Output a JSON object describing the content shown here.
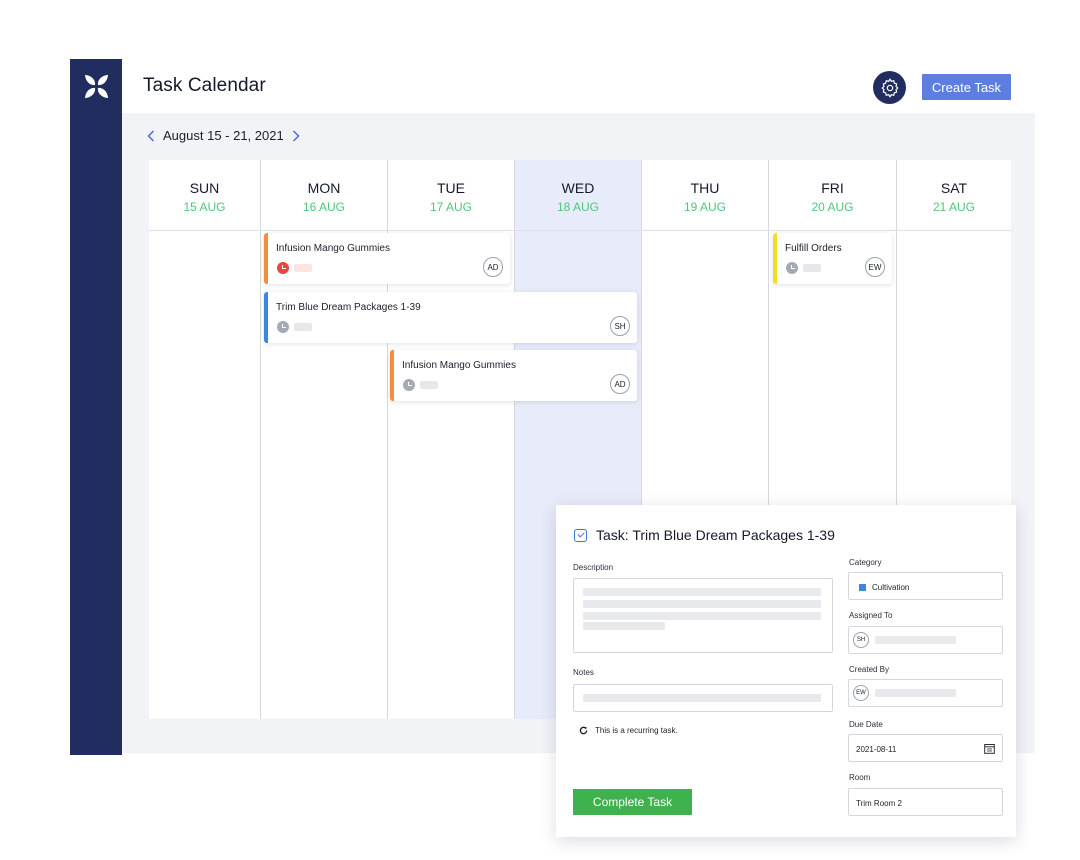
{
  "header": {
    "title": "Task Calendar",
    "create_label": "Create Task"
  },
  "nav": {
    "week_range": "August 15 - 21, 2021"
  },
  "days": [
    {
      "name": "SUN",
      "date": "15 AUG"
    },
    {
      "name": "MON",
      "date": "16 AUG"
    },
    {
      "name": "TUE",
      "date": "17 AUG"
    },
    {
      "name": "WED",
      "date": "18 AUG",
      "today": true
    },
    {
      "name": "THU",
      "date": "19 AUG"
    },
    {
      "name": "FRI",
      "date": "20 AUG"
    },
    {
      "name": "SAT",
      "date": "21 AUG"
    }
  ],
  "tasks": [
    {
      "title": "Infusion Mango Gummies",
      "assignee": "AD",
      "color": "#f58b3c",
      "status": "overdue",
      "days": [
        "MON",
        "TUE"
      ]
    },
    {
      "title": "Trim Blue Dream Packages 1-39",
      "assignee": "SH",
      "color": "#3b87e0",
      "status": "pending",
      "days": [
        "MON",
        "WED"
      ]
    },
    {
      "title": "Infusion Mango Gummies",
      "assignee": "AD",
      "color": "#f58b3c",
      "status": "pending",
      "days": [
        "TUE",
        "WED"
      ]
    },
    {
      "title": "Fulfill Orders",
      "assignee": "EW",
      "color": "#f5dc2b",
      "status": "pending",
      "days": [
        "FRI"
      ]
    }
  ],
  "detail": {
    "title": "Task: Trim Blue Dream Packages 1-39",
    "description_label": "Description",
    "notes_label": "Notes",
    "recurring_text": "This is a recurring task.",
    "category_label": "Category",
    "category_value": "Cultivation",
    "category_color": "#3b87e0",
    "assigned_label": "Assigned To",
    "assigned_initials": "SH",
    "created_label": "Created By",
    "created_initials": "EW",
    "due_label": "Due Date",
    "due_value": "2021-08-11",
    "room_label": "Room",
    "room_value": "Trim Room 2",
    "complete_label": "Complete Task"
  },
  "colors": {
    "sidebar": "#222d5f",
    "primary": "#5b7ee0",
    "today_column": "#e8ebf9",
    "date_green": "#52c57b",
    "complete_green": "#3fb24d",
    "overdue": "#e3473f",
    "pending": "#a4a9b3"
  }
}
